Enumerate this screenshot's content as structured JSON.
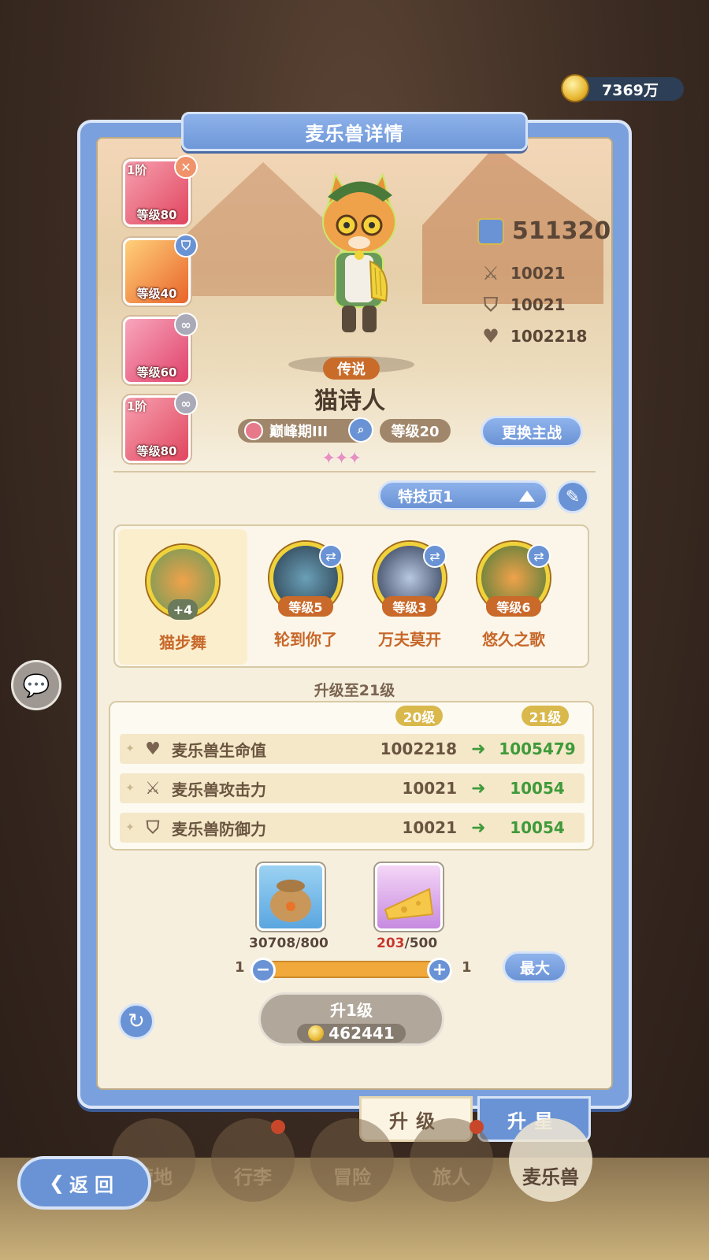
{
  "currency": {
    "amount": "7369万",
    "icon": "gold-coin-icon"
  },
  "panel": {
    "title": "麦乐兽详情"
  },
  "skills": [
    {
      "tier": "1阶",
      "level": "等级80",
      "badge": "sword-icon",
      "color": "#e8526a"
    },
    {
      "tier": "",
      "level": "等级40",
      "badge": "shield-icon",
      "color": "#f08a3a"
    },
    {
      "tier": "",
      "level": "等级60",
      "badge": "link-icon",
      "color": "#e84a6a"
    },
    {
      "tier": "1阶",
      "level": "等级80",
      "badge": "link-icon",
      "color": "#e8526a"
    }
  ],
  "hero": {
    "rarity": "传说",
    "name": "猫诗人",
    "stage": "巅峰期III",
    "level": "等级20",
    "stars": "✦✦✦",
    "switch_label": "更换主战"
  },
  "stats": {
    "power": "511320",
    "attack": "10021",
    "defense": "10021",
    "hp": "1002218"
  },
  "trick_page": {
    "label": "特技页1"
  },
  "tricks": {
    "main": {
      "name": "猫步舞",
      "bonus": "+4"
    },
    "items": [
      {
        "name": "轮到你了",
        "level": "等级5"
      },
      {
        "name": "万夫莫开",
        "level": "等级3"
      },
      {
        "name": "悠久之歌",
        "level": "等级6"
      }
    ]
  },
  "upgrade": {
    "title": "升级至21级",
    "from_level": "20级",
    "to_level": "21级",
    "rows": [
      {
        "label": "麦乐兽生命值",
        "icon": "heart-icon",
        "old": "1002218",
        "new": "1005479"
      },
      {
        "label": "麦乐兽攻击力",
        "icon": "sword-icon",
        "old": "10021",
        "new": "10054"
      },
      {
        "label": "麦乐兽防御力",
        "icon": "shield-icon",
        "old": "10021",
        "new": "10054"
      }
    ]
  },
  "materials": [
    {
      "name": "food-bag",
      "have": "30708",
      "need": "/800"
    },
    {
      "name": "cheese",
      "have": "203",
      "need": "/500"
    }
  ],
  "slider": {
    "min": "1",
    "max": "1",
    "max_label": "最大"
  },
  "upgrade_button": {
    "label": "升1级",
    "cost": "462441"
  },
  "tabs": {
    "upgrade": "升级",
    "star": "升星"
  },
  "nav": {
    "items": [
      "营地",
      "行李",
      "冒险",
      "旅人",
      "麦乐兽"
    ]
  },
  "back": {
    "label": "返回"
  }
}
